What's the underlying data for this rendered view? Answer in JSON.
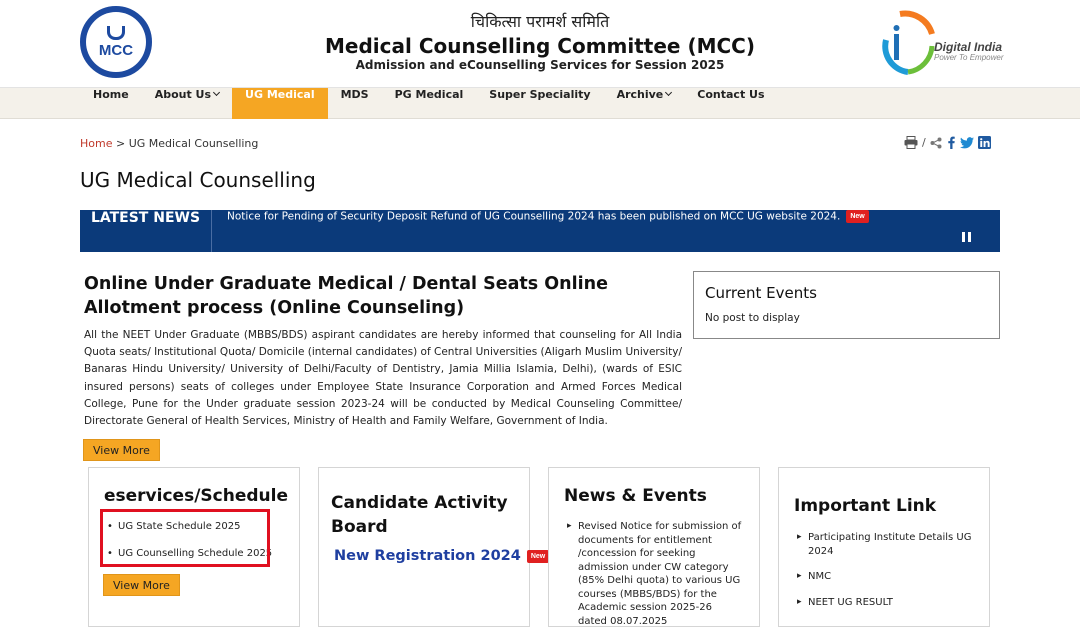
{
  "header": {
    "logo_text": "MCC",
    "hindi_title": "चिकित्सा परामर्श समिति",
    "title": "Medical Counselling Committee (MCC)",
    "subtitle": "Admission and eCounselling Services for Session 2025",
    "digital_india": "Digital India",
    "digital_india_tagline": "Power To Empower"
  },
  "nav": {
    "items": [
      {
        "label": "Home",
        "dropdown": false,
        "active": false
      },
      {
        "label": "About Us",
        "dropdown": true,
        "active": false
      },
      {
        "label": "UG Medical",
        "dropdown": false,
        "active": true
      },
      {
        "label": "MDS",
        "dropdown": false,
        "active": false
      },
      {
        "label": "PG Medical",
        "dropdown": false,
        "active": false
      },
      {
        "label": "Super Speciality",
        "dropdown": false,
        "active": false
      },
      {
        "label": "Archive",
        "dropdown": true,
        "active": false
      },
      {
        "label": "Contact Us",
        "dropdown": false,
        "active": false
      }
    ]
  },
  "breadcrumb": {
    "home": "Home",
    "separator": ">",
    "current": "UG Medical Counselling"
  },
  "share": {
    "separator": "/"
  },
  "page_title": "UG Medical Counselling",
  "latest_news": {
    "label": "LATEST NEWS",
    "text": "Notice for Pending of Security Deposit Refund of UG Counselling 2024 has been published on MCC UG website 2024.",
    "badge": "New"
  },
  "main": {
    "heading": "Online Under Graduate Medical / Dental Seats Online Allotment process (Online Counseling)",
    "paragraph": "All the NEET Under Graduate (MBBS/BDS) aspirant candidates are hereby informed that counseling for All India Quota seats/ Institutional Quota/ Domicile (internal candidates) of Central Universities (Aligarh Muslim University/ Banaras Hindu University/ University of Delhi/Faculty of Dentistry, Jamia Millia Islamia, Delhi), (wards of ESIC insured persons) seats of colleges under Employee State Insurance Corporation and Armed Forces Medical College, Pune for the Under graduate session 2023-24 will be conducted by Medical Counseling Committee/ Directorate General of Health Services, Ministry of Health and Family Welfare, Government of India.",
    "view_more": "View More"
  },
  "current_events": {
    "title": "Current Events",
    "empty": "No post to display"
  },
  "eservices": {
    "title": "eservices/Schedule",
    "items": [
      "UG State Schedule 2025",
      "UG Counselling Schedule 2025"
    ],
    "view_more": "View More"
  },
  "activity": {
    "title": "Candidate Activity Board",
    "link": "New Registration 2024",
    "badge": "New"
  },
  "news_events": {
    "title": "News & Events",
    "items": [
      "Revised Notice for submission of documents for entitlement /concession for seeking admission under CW category (85% Delhi quota) to various UG courses (MBBS/BDS) for the Academic session 2025-26 dated 08.07.2025"
    ]
  },
  "important": {
    "title": "Important Link",
    "items": [
      "Participating Institute Details UG 2024",
      "NMC",
      "NEET UG RESULT"
    ]
  },
  "colors": {
    "navy": "#0b3a7a",
    "orange": "#f5a623",
    "highlight": "#e01020",
    "link_blue": "#1f3fa0"
  }
}
